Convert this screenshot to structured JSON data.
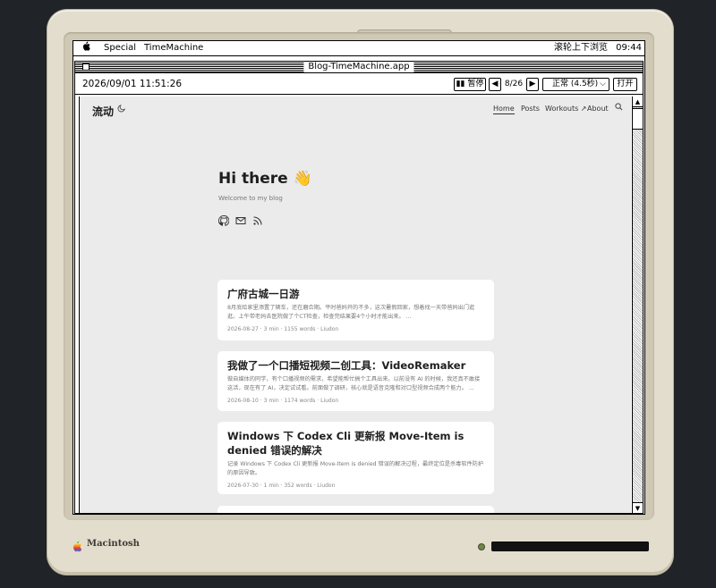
{
  "menubar": {
    "apple": "",
    "menus": [
      "Special",
      "TimeMachine"
    ],
    "hint": "滚轮上下浏览",
    "clock": "09:44"
  },
  "window": {
    "title": "Blog-TimeMachine.app"
  },
  "toolbar": {
    "datetime": "2026/09/01 11:51:26",
    "pause_label": "▮▮ 暂停",
    "prev_label": "◀",
    "counter": "8/26",
    "next_label": "▶",
    "speed_value": "正常 (4.5秒)",
    "open_label": "打开"
  },
  "site": {
    "logo": "流动",
    "theme_icon": "moon-icon",
    "nav": [
      "Home",
      "Posts",
      "Workouts ↗",
      "About"
    ],
    "search_icon": "search-icon",
    "hero_title": "Hi there 👋",
    "hero_subtitle": "Welcome to my blog",
    "social_icons": [
      "github-icon",
      "mail-icon",
      "rss-icon"
    ],
    "posts": [
      {
        "title": "广府古城一日游",
        "summary": "8月底给家里添置了辆车，还在磨合期。平时爸妈开的不多，这次暑假回家，想着找一天带爸妈出门逛逛。上午带老妈去医院做了个CT检查，检查完结果要4个小时才能出来。 ...",
        "meta": "2026-08-27 · 3 min · 1155 words · Liudon"
      },
      {
        "title": "我做了一个口播短视频二创工具：VideoRemaker",
        "summary": "做自媒体的同学，有个口播视频的需求，希望能帮忙搞个工具出来。以前没有 AI 的时候，我还真不敢接这活，现在有了 AI，决定试试看。前面做了调研，核心就是语音克隆和对口型视频合成两个能力。 ...",
        "meta": "2026-08-10 · 3 min · 1174 words · Liudon"
      },
      {
        "title": "Windows 下 Codex Cli 更新报 Move-Item is denied 错误的解决",
        "summary": "记录 Windows 下 Codex Cli 更新报 Move-Item is denied 错误的解决过程，最终定位是杀毒软件防护的原因导致。",
        "meta": "2026-07-30 · 1 min · 352 words · Liudon"
      }
    ]
  },
  "case": {
    "brand": "Macintosh",
    "logo_icon": "rainbow-apple-icon"
  }
}
